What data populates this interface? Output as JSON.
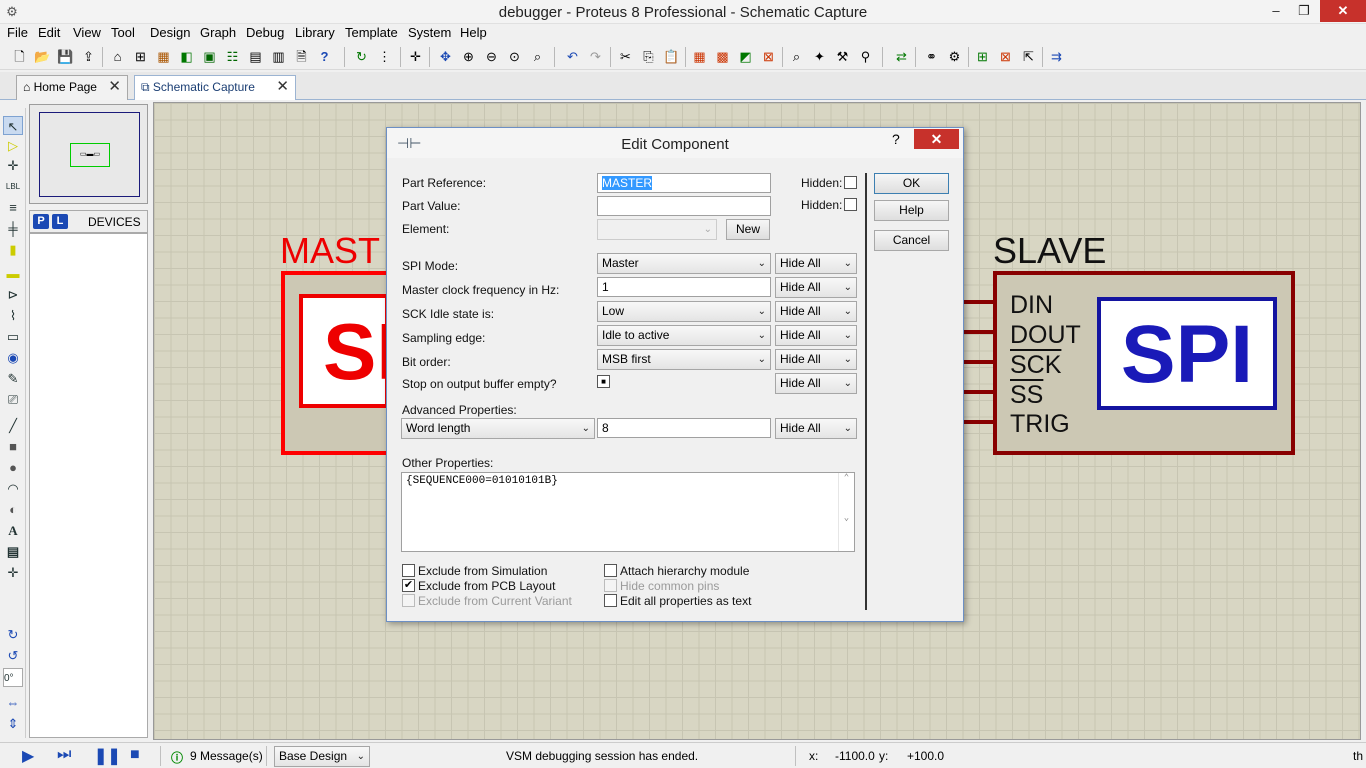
{
  "window": {
    "title": "debugger - Proteus 8 Professional - Schematic Capture",
    "minimize": "‒",
    "restore": "❐",
    "close": "✕"
  },
  "menu": [
    "File",
    "Edit",
    "View",
    "Tool",
    "Design",
    "Graph",
    "Debug",
    "Library",
    "Template",
    "System",
    "Help"
  ],
  "tabs": [
    {
      "label": "Home Page",
      "close": "✕"
    },
    {
      "label": "Schematic Capture",
      "close": "✕"
    }
  ],
  "sidebar": {
    "p_button": "P",
    "l_button": "L",
    "devices_label": "DEVICES",
    "rotation_value": "0°"
  },
  "overview": {
    "mini_label": "▭▬▭"
  },
  "schematic": {
    "master_label": "MAST",
    "master_block_text": "SP",
    "slave_label": "SLAVE",
    "slave_block_text": "SPI",
    "slave_pins": [
      "DIN",
      "DOUT",
      "SCK",
      "SS",
      "TRIG"
    ]
  },
  "dialog": {
    "title": "Edit Component",
    "help_glyph": "?",
    "close_glyph": "✕",
    "part_reference_label": "Part Reference:",
    "part_reference_value": "MASTER",
    "part_value_label": "Part Value:",
    "part_value_value": "",
    "element_label": "Element:",
    "new_button": "New",
    "hidden_label": "Hidden:",
    "ok_button": "OK",
    "help_button": "Help",
    "cancel_button": "Cancel",
    "properties": [
      {
        "label": "SPI Mode:",
        "value": "Master",
        "kind": "select",
        "vis": "Hide All"
      },
      {
        "label": "Master clock frequency in Hz:",
        "value": "1",
        "kind": "input",
        "vis": "Hide All"
      },
      {
        "label": "SCK Idle state is:",
        "value": "Low",
        "kind": "select",
        "vis": "Hide All"
      },
      {
        "label": "Sampling edge:",
        "value": "Idle to active",
        "kind": "select",
        "vis": "Hide All"
      },
      {
        "label": "Bit order:",
        "value": "MSB first",
        "kind": "select",
        "vis": "Hide All"
      },
      {
        "label": "Stop on output buffer empty?",
        "value": "■",
        "kind": "check",
        "vis": "Hide All"
      }
    ],
    "advanced_label": "Advanced Properties:",
    "advanced_select": "Word length",
    "advanced_value": "8",
    "advanced_vis": "Hide All",
    "other_label": "Other Properties:",
    "other_text": "{SEQUENCE000=01010101B}",
    "checks": {
      "exclude_sim": "Exclude from Simulation",
      "exclude_pcb": "Exclude from PCB Layout",
      "exclude_variant": "Exclude from Current Variant",
      "attach_hier": "Attach hierarchy module",
      "hide_pins": "Hide common pins",
      "edit_all": "Edit all properties as text"
    },
    "checked_mark": "✔"
  },
  "status": {
    "messages": "9 Message(s)",
    "design": "Base Design",
    "info": "VSM debugging session has ended.",
    "x_label": "x:",
    "x_value": "-1100.0",
    "y_label": "y:",
    "y_value": "+100.0",
    "tail": "th"
  },
  "colors": {
    "master": "#ff0000",
    "slave": "#800000",
    "spi_blue": "#1a1ab8",
    "canvas": "#d8d6c3"
  }
}
